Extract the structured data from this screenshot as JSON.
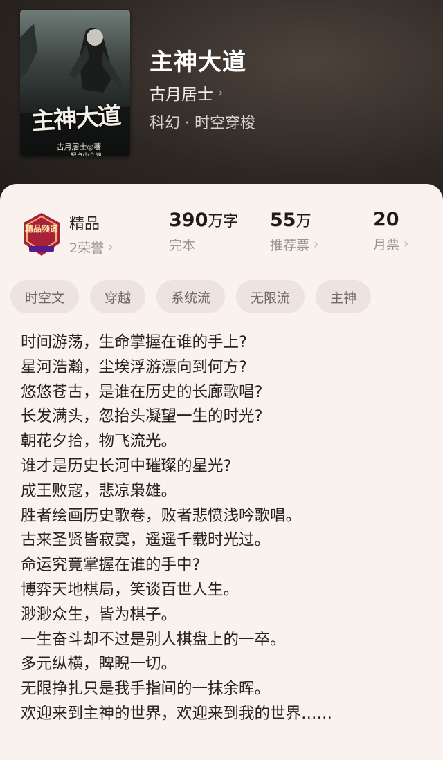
{
  "book": {
    "title": "主神大道",
    "author": "古月居士",
    "genre": "科幻 · 时空穿梭",
    "cover": {
      "title_art": "主神大道",
      "author_line": "古月居士◎著",
      "publisher": "起点中文网"
    }
  },
  "badge": {
    "icon": "jingpin-badge-icon",
    "art_text": "精品频道",
    "label": "精品",
    "honors": "2荣誉"
  },
  "stats": [
    {
      "value": "390",
      "unit": "万字",
      "label": "完本",
      "chevron": false
    },
    {
      "value": "55",
      "unit": "万",
      "label": "推荐票",
      "chevron": true
    },
    {
      "value": "20",
      "unit": "",
      "label": "月票",
      "chevron": true
    }
  ],
  "tags": [
    "时空文",
    "穿越",
    "系统流",
    "无限流",
    "主神"
  ],
  "description": [
    "时间游荡，生命掌握在谁的手上?",
    "星河浩瀚，尘埃浮游漂向到何方?",
    "悠悠苍古，是谁在历史的长廊歌唱?",
    "长发满头，忽抬头凝望一生的时光?",
    "朝花夕拾，物飞流光。",
    "谁才是历史长河中璀璨的星光?",
    "成王败寇，悲凉枭雄。",
    "胜者绘画历史歌卷，败者悲愤浅吟歌唱。",
    "古来圣贤皆寂寞，遥遥千载时光过。",
    "命运究竟掌握在谁的手中?",
    "博弈天地棋局，笑谈百世人生。",
    "渺渺众生，皆为棋子。",
    "一生奋斗却不过是别人棋盘上的一卒。",
    "多元纵横，睥睨一切。",
    "无限挣扎只是我手指间的一抹余晖。",
    "欢迎来到主神的世界，欢迎来到我的世界……"
  ],
  "icons": {
    "chevron": "chevron-right-icon"
  },
  "colors": {
    "header_bg": "#2e2824",
    "card_bg": "#faf2ef",
    "tag_bg": "#ede4e0",
    "badge_red": "#a8203a"
  }
}
